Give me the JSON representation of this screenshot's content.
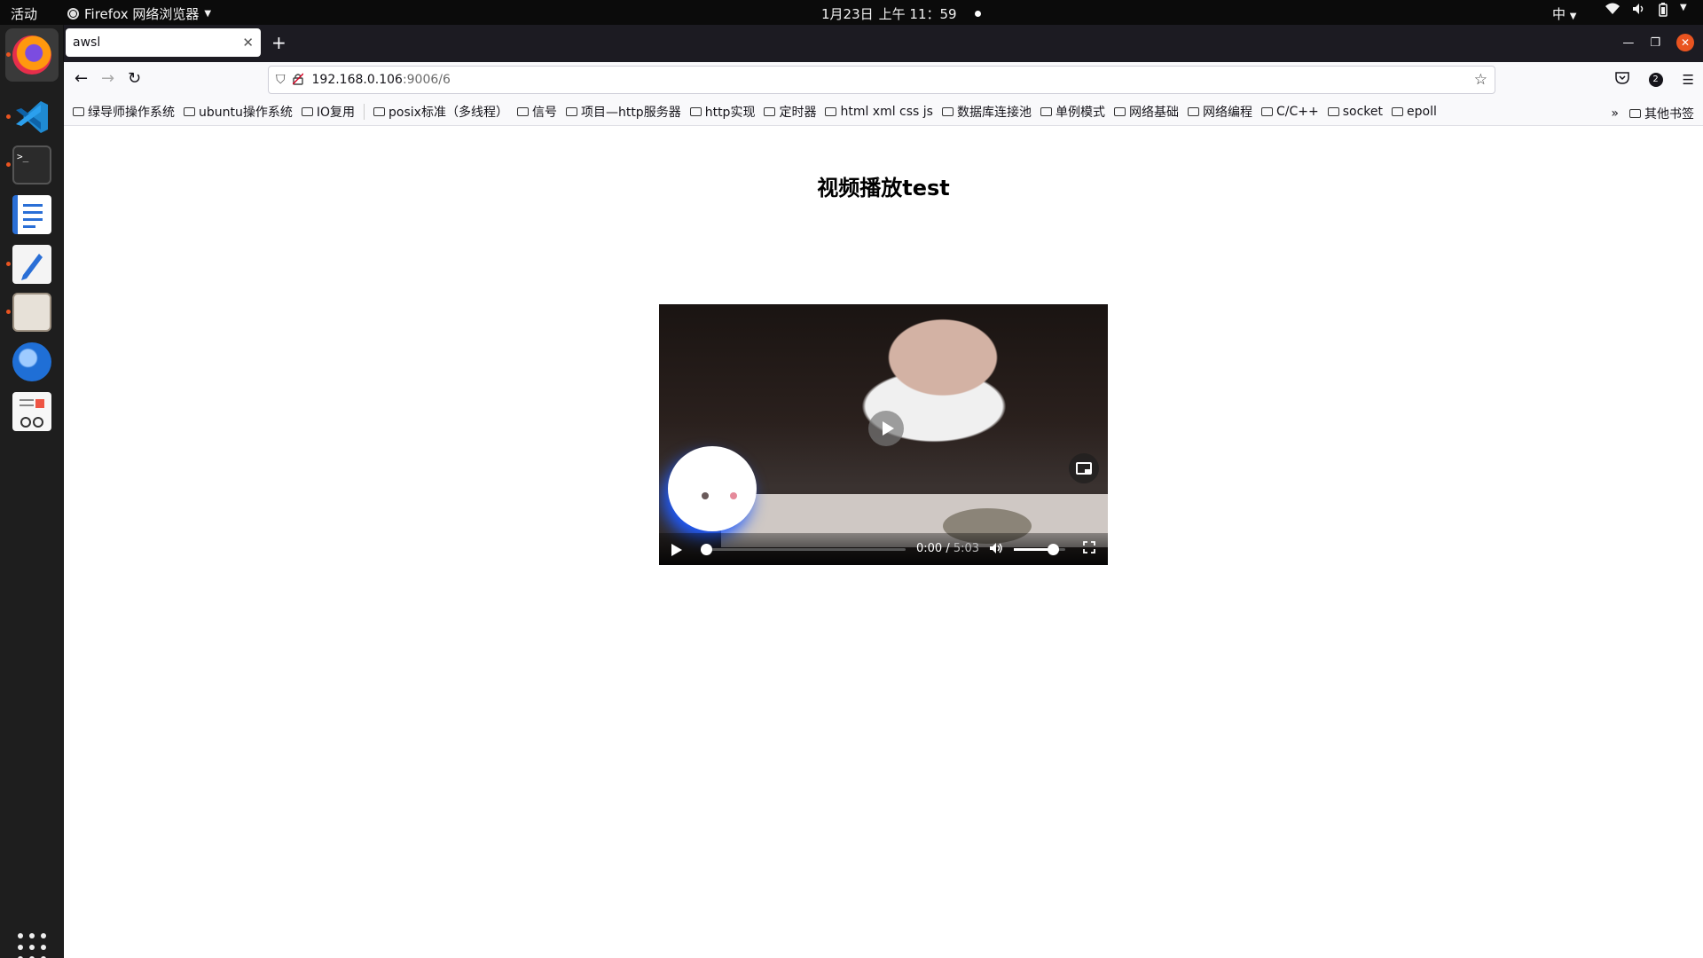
{
  "topbar": {
    "activities": "活动",
    "app_name": "Firefox 网络浏览器",
    "date": "1月23日",
    "time": "上午 11：59",
    "ime": "中"
  },
  "dock": {
    "items": [
      {
        "name": "firefox-icon",
        "running": true,
        "active": true
      },
      {
        "name": "vscode-icon",
        "running": true
      },
      {
        "name": "terminal-icon",
        "running": true
      },
      {
        "name": "libreoffice-writer-icon",
        "running": false
      },
      {
        "name": "text-editor-icon",
        "running": true
      },
      {
        "name": "files-icon",
        "running": true
      },
      {
        "name": "thunderbird-icon",
        "running": false
      },
      {
        "name": "document-viewer-icon",
        "running": false
      }
    ]
  },
  "browser": {
    "tab_title": "awsl",
    "url_host": "192.168.0.106",
    "url_path": ":9006/6",
    "bookmarks": [
      "绿导师操作系统",
      "ubuntu操作系统",
      "IO复用",
      "posix标准（多线程）",
      "信号",
      "项目—http服务器",
      "http实现",
      "定时器",
      "html xml css js",
      "数据库连接池",
      "单例模式",
      "网络基础",
      "网络编程",
      "C/C++",
      "socket",
      "epoll"
    ],
    "other_bookmarks": "其他书签",
    "account_badge": "2"
  },
  "page": {
    "heading": "视频播放test"
  },
  "video": {
    "current_time": "0:00",
    "duration": "5:03",
    "progress_fraction": 0.01,
    "volume_fraction": 0.75
  },
  "colors": {
    "ubuntu_orange": "#e95420",
    "tabbar": "#1c1b22"
  }
}
